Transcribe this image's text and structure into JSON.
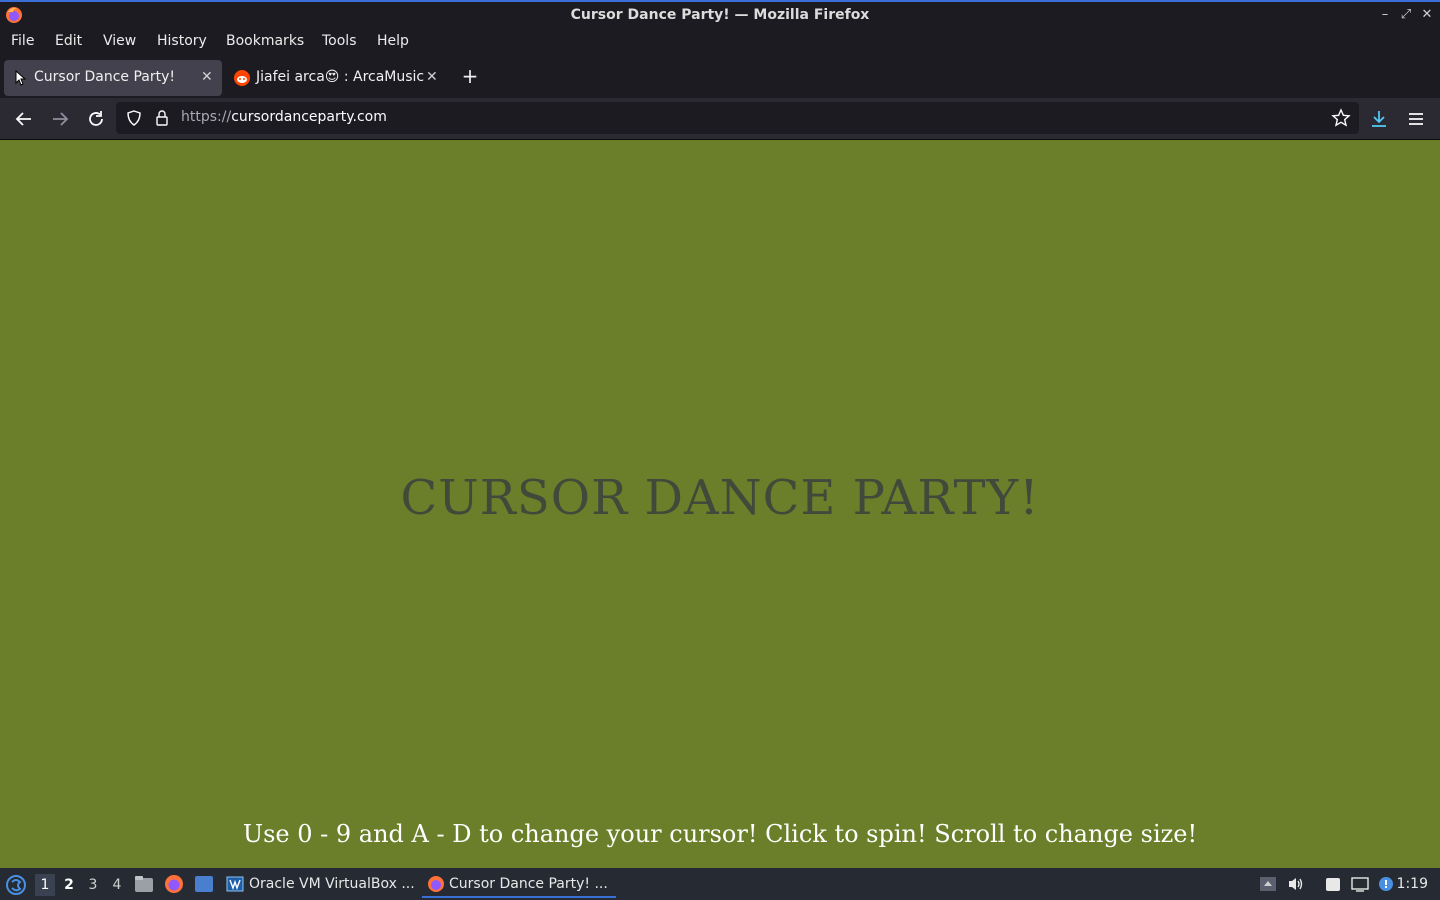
{
  "window": {
    "title": "Cursor Dance Party! — Mozilla Firefox"
  },
  "menubar": {
    "items": [
      "File",
      "Edit",
      "View",
      "History",
      "Bookmarks",
      "Tools",
      "Help"
    ]
  },
  "tabs": [
    {
      "label": "Cursor Dance Party!",
      "active": true,
      "icon": "cursor-icon"
    },
    {
      "label": "Jiafei arca😍 : ArcaMusic",
      "active": false,
      "icon": "reddit-icon"
    }
  ],
  "navbar": {
    "url_scheme": "https://",
    "url_host": "cursordanceparty.com"
  },
  "page": {
    "background": "#6b7f2a",
    "headline": "CURSOR DANCE PARTY!",
    "instructions": "Use 0 - 9 and A - D to change your cursor! Click to spin! Scroll to change size!"
  },
  "taskbar": {
    "workspaces": [
      "1",
      "2",
      "3",
      "4"
    ],
    "tasks": [
      {
        "label": "Oracle VM VirtualBox ...",
        "active": false
      },
      {
        "label": "Cursor Dance Party! ...",
        "active": true
      }
    ],
    "clock": "1:19"
  },
  "colors": {
    "accent": "#3b6fd8",
    "download_icon": "#54c8f0"
  }
}
